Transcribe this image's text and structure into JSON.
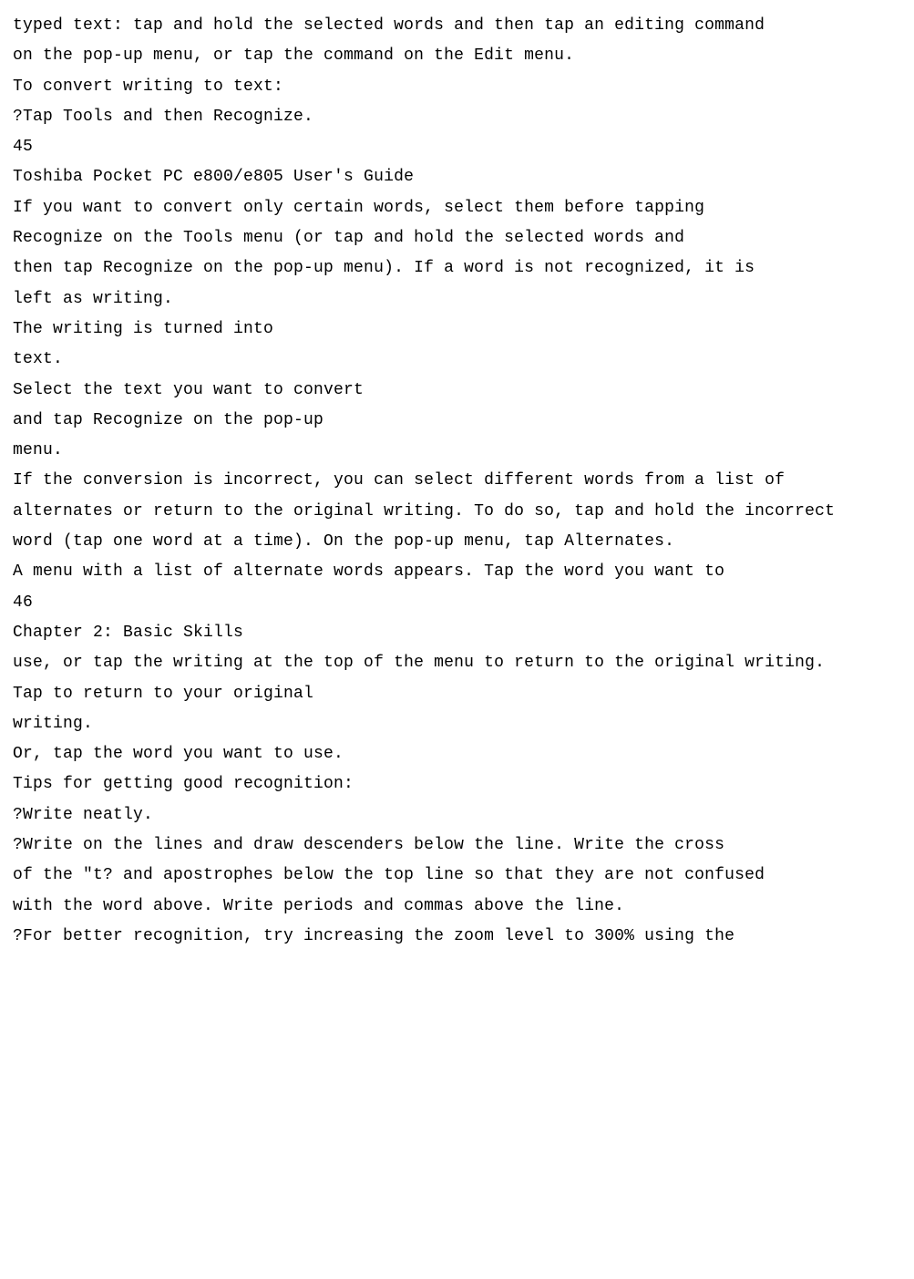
{
  "lines": [
    "typed text: tap and hold the selected words and then tap an editing command",
    "on the pop-up menu, or tap the command on the Edit menu.",
    "To convert writing to text:",
    "?Tap Tools and then Recognize.",
    "45",
    "Toshiba Pocket PC e800/e805 User's Guide",
    "If you want to convert only certain words, select them before tapping",
    "Recognize on the Tools menu (or tap and hold the selected words and",
    "then tap Recognize on the pop-up menu). If a word is not recognized, it is",
    "left as writing.",
    "The writing is turned into",
    "text.",
    "Select the text you want to convert",
    "and tap Recognize on the pop-up",
    "menu.",
    "If the conversion is incorrect, you can select different words from a list of",
    "alternates or return to the original writing. To do so, tap and hold the incorrect",
    "word (tap one word at a time). On the pop-up menu, tap Alternates.",
    "A menu with a list of alternate words appears. Tap the word you want to",
    "46",
    "Chapter 2: Basic Skills",
    "use, or tap the writing at the top of the menu to return to the original writing.",
    "Tap to return to your original",
    "writing.",
    "Or, tap the word you want to use.",
    "Tips for getting good recognition:",
    "?Write neatly.",
    "?Write on the lines and draw descenders below the line. Write the cross",
    "of the \"t? and apostrophes below the top line so that they are not confused",
    "with the word above. Write periods and commas above the line.",
    "?For better recognition, try increasing the zoom level to 300% using the"
  ]
}
